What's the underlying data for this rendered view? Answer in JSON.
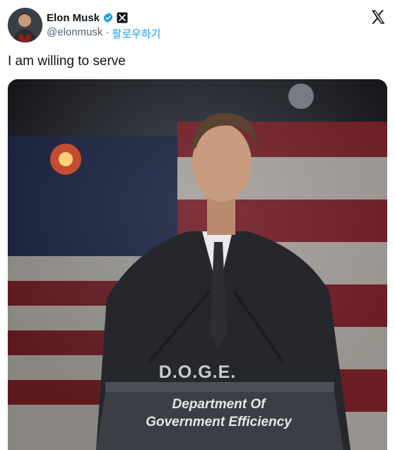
{
  "author": {
    "display_name": "Elon Musk",
    "handle": "@elonmusk",
    "separator": "·",
    "follow_label": "팔로우하기",
    "verified_icon": "verified-badge-icon",
    "affiliation_icon": "x-badge-icon"
  },
  "brand": {
    "logo_icon": "x-logo-icon"
  },
  "tweet": {
    "text": "I am willing to serve"
  },
  "media": {
    "podium_top_text": "D.O.G.E.",
    "podium_line_1": "Department Of",
    "podium_line_2": "Government Efficiency"
  },
  "colors": {
    "verified": "#1d9bf0",
    "follow_link": "#1d9bf0",
    "text_primary": "#0f1419",
    "text_secondary": "#536471"
  }
}
